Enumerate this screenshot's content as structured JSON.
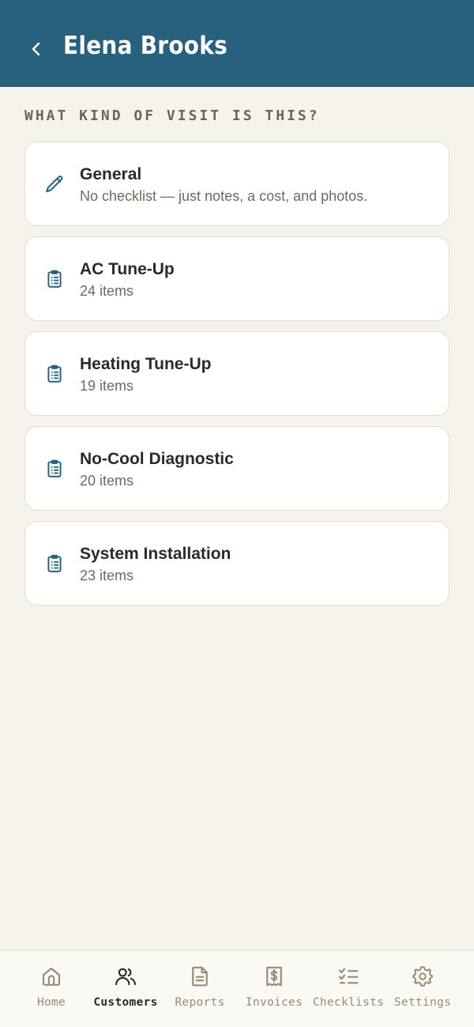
{
  "header": {
    "title": "Elena Brooks",
    "back_icon": "chevron-left-icon"
  },
  "section_label": "WHAT KIND OF VISIT IS THIS?",
  "visit_types": [
    {
      "title": "General",
      "subtitle": "No checklist — just notes, a cost, and photos.",
      "icon": "pencil-icon"
    },
    {
      "title": "AC Tune-Up",
      "subtitle": "24 items",
      "icon": "clipboard-list-icon"
    },
    {
      "title": "Heating Tune-Up",
      "subtitle": "19 items",
      "icon": "clipboard-list-icon"
    },
    {
      "title": "No-Cool Diagnostic",
      "subtitle": "20 items",
      "icon": "clipboard-list-icon"
    },
    {
      "title": "System Installation",
      "subtitle": "23 items",
      "icon": "clipboard-list-icon"
    }
  ],
  "bottom_nav": {
    "items": [
      {
        "label": "Home",
        "icon": "home-icon",
        "active": false
      },
      {
        "label": "Customers",
        "icon": "users-icon",
        "active": true
      },
      {
        "label": "Reports",
        "icon": "document-icon",
        "active": false
      },
      {
        "label": "Invoices",
        "icon": "receipt-dollar-icon",
        "active": false
      },
      {
        "label": "Checklists",
        "icon": "checklist-icon",
        "active": false
      },
      {
        "label": "Settings",
        "icon": "gear-icon",
        "active": false
      }
    ]
  },
  "colors": {
    "header_bg": "#27617d",
    "page_bg": "#f6f3ec",
    "accent": "#27617d",
    "nav_inactive": "#9a8a72",
    "nav_active": "#2d2a26"
  }
}
